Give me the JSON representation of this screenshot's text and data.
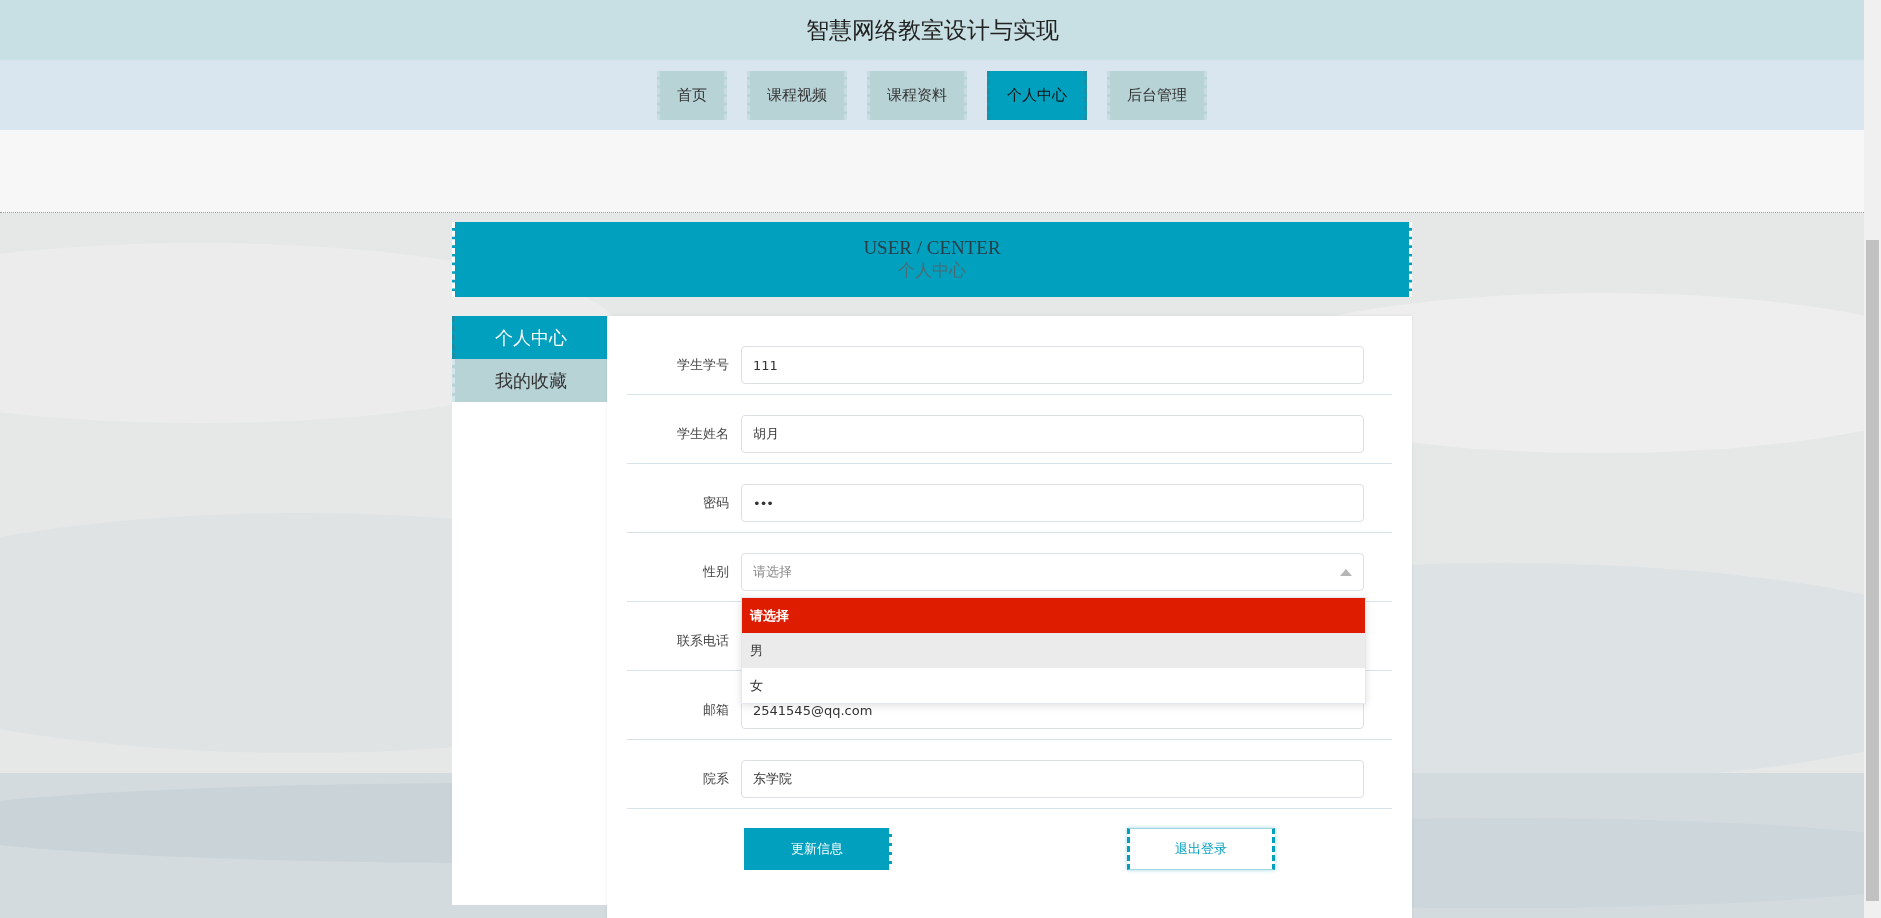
{
  "header": {
    "title": "智慧网络教室设计与实现"
  },
  "nav": [
    {
      "label": "首页",
      "selected": false
    },
    {
      "label": "课程视频",
      "selected": false
    },
    {
      "label": "课程资料",
      "selected": false
    },
    {
      "label": "个人中心",
      "selected": true
    },
    {
      "label": "后台管理",
      "selected": false
    }
  ],
  "banner": {
    "title": "USER / CENTER",
    "subtitle": "个人中心"
  },
  "sidebar": [
    {
      "label": "个人中心",
      "selected": true
    },
    {
      "label": "我的收藏",
      "selected": false
    }
  ],
  "form": {
    "fields": [
      {
        "kind": "text",
        "label": "学生学号",
        "value": "111"
      },
      {
        "kind": "text",
        "label": "学生姓名",
        "value": "胡月"
      },
      {
        "kind": "password",
        "label": "密码",
        "value": "•••"
      },
      {
        "kind": "select",
        "label": "性别",
        "placeholder": "请选择",
        "expanded": true,
        "options": [
          {
            "label": "请选择",
            "selected": true,
            "hovered": false
          },
          {
            "label": "男",
            "selected": false,
            "hovered": true
          },
          {
            "label": "女",
            "selected": false,
            "hovered": false
          }
        ]
      },
      {
        "kind": "text",
        "label": "联系电话"
      },
      {
        "kind": "text",
        "label": "邮箱",
        "value": "2541545@qq.com"
      },
      {
        "kind": "text",
        "label": "院系",
        "value": "东学院"
      }
    ],
    "buttons": [
      {
        "kind": "primary",
        "label": "更新信息"
      },
      {
        "kind": "outline",
        "label": "退出登录"
      }
    ]
  }
}
